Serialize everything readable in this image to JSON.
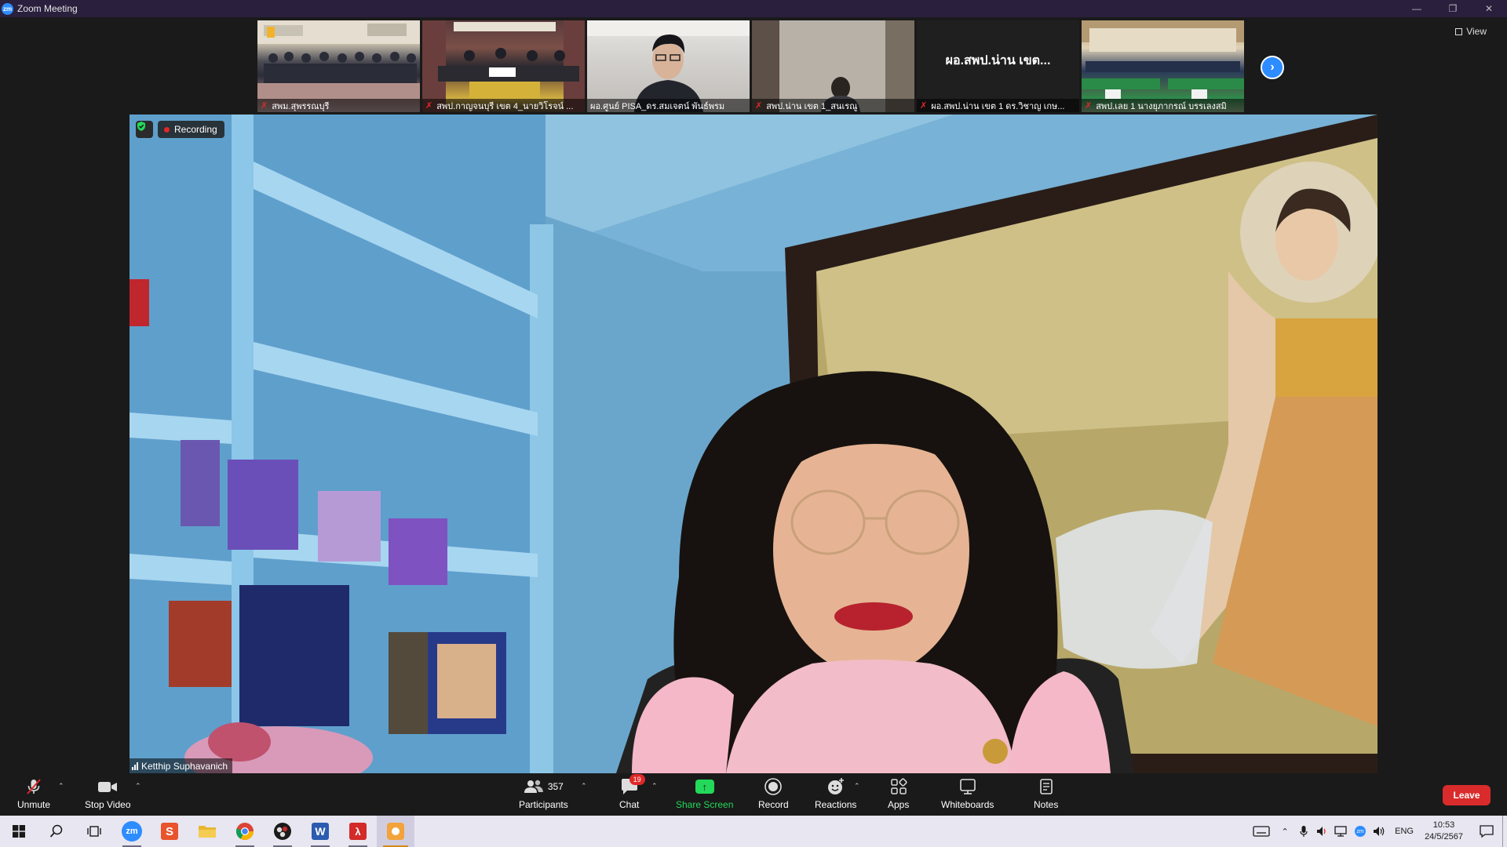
{
  "window": {
    "title": "Zoom Meeting",
    "logo_text": "zm"
  },
  "view_button": {
    "label": "View"
  },
  "thumbnails": [
    {
      "name": "สพม.สุพรรณบุรี",
      "muted": true
    },
    {
      "name": "สพป.กาญจนบุรี เขต 4_นายวิโรจน์ ...",
      "muted": true
    },
    {
      "name": "ผอ.ศูนย์ PISA_ดร.สมเจตน์ พันธ์พรม",
      "muted": false
    },
    {
      "name": "สพป.น่าน เขต 1_สนเรณู",
      "muted": true
    },
    {
      "name": "ผอ.สพป.น่าน เขต 1 ดร.วิชาญ เกษ...",
      "muted": true,
      "display_text": "ผอ.สพป.น่าน เขต..."
    },
    {
      "name": "สพป.เลย 1 นางยุภากรณ์ บรรเลงสมิ",
      "muted": true
    }
  ],
  "recording": {
    "label": "Recording"
  },
  "active_speaker": {
    "name": "Ketthip Suphavanich"
  },
  "toolbar": {
    "unmute": "Unmute",
    "stop_video": "Stop Video",
    "participants": "Participants",
    "participants_count": "357",
    "chat": "Chat",
    "chat_badge": "19",
    "share_screen": "Share Screen",
    "record": "Record",
    "reactions": "Reactions",
    "apps": "Apps",
    "whiteboards": "Whiteboards",
    "notes": "Notes",
    "leave": "Leave"
  },
  "taskbar": {
    "apps": [
      "start-icon",
      "search-icon",
      "task-view-icon",
      "zoom-icon",
      "slides-icon",
      "file-explorer-icon",
      "chrome-icon",
      "obs-icon",
      "word-icon",
      "acrobat-icon",
      "app-icon"
    ],
    "language": "ENG",
    "time": "10:53",
    "date": "24/5/2567"
  },
  "colors": {
    "zoom_blue": "#2d8cff",
    "share_green": "#23d959",
    "leave_red": "#d92b2b",
    "recording_red": "#e02828"
  }
}
